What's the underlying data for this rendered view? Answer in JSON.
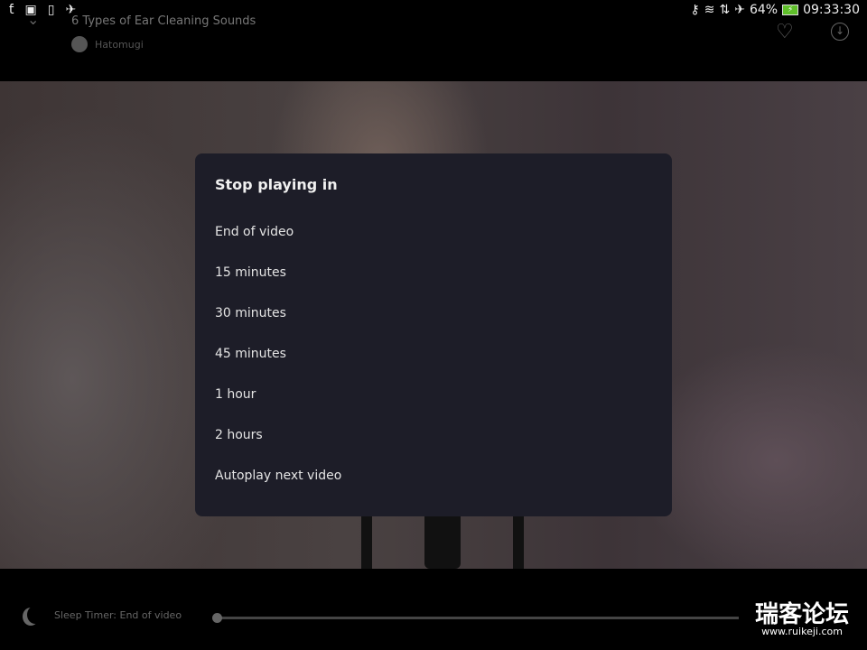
{
  "status_bar": {
    "battery": "64%",
    "time": "09:33:30",
    "icons": [
      "app-icon",
      "image-icon",
      "vibrate-icon",
      "rocket-icon",
      "key-icon",
      "wifi-icon",
      "data-icon",
      "airplane-icon",
      "battery-charging-icon"
    ]
  },
  "header": {
    "title": "6 Types of Ear Cleaning Sounds",
    "channel": "Hatomugi",
    "icons": [
      "chevron-down-icon",
      "heart-icon",
      "download-icon"
    ]
  },
  "dialog": {
    "title": "Stop playing in",
    "options": [
      "End of video",
      "15 minutes",
      "30 minutes",
      "45 minutes",
      "1 hour",
      "2 hours",
      "Autoplay next video"
    ]
  },
  "bottom": {
    "sleep_timer": "Sleep Timer: End of video",
    "progress": 0
  },
  "watermark": {
    "line1": "瑞客论坛",
    "line2": "www.ruikeji.com"
  }
}
